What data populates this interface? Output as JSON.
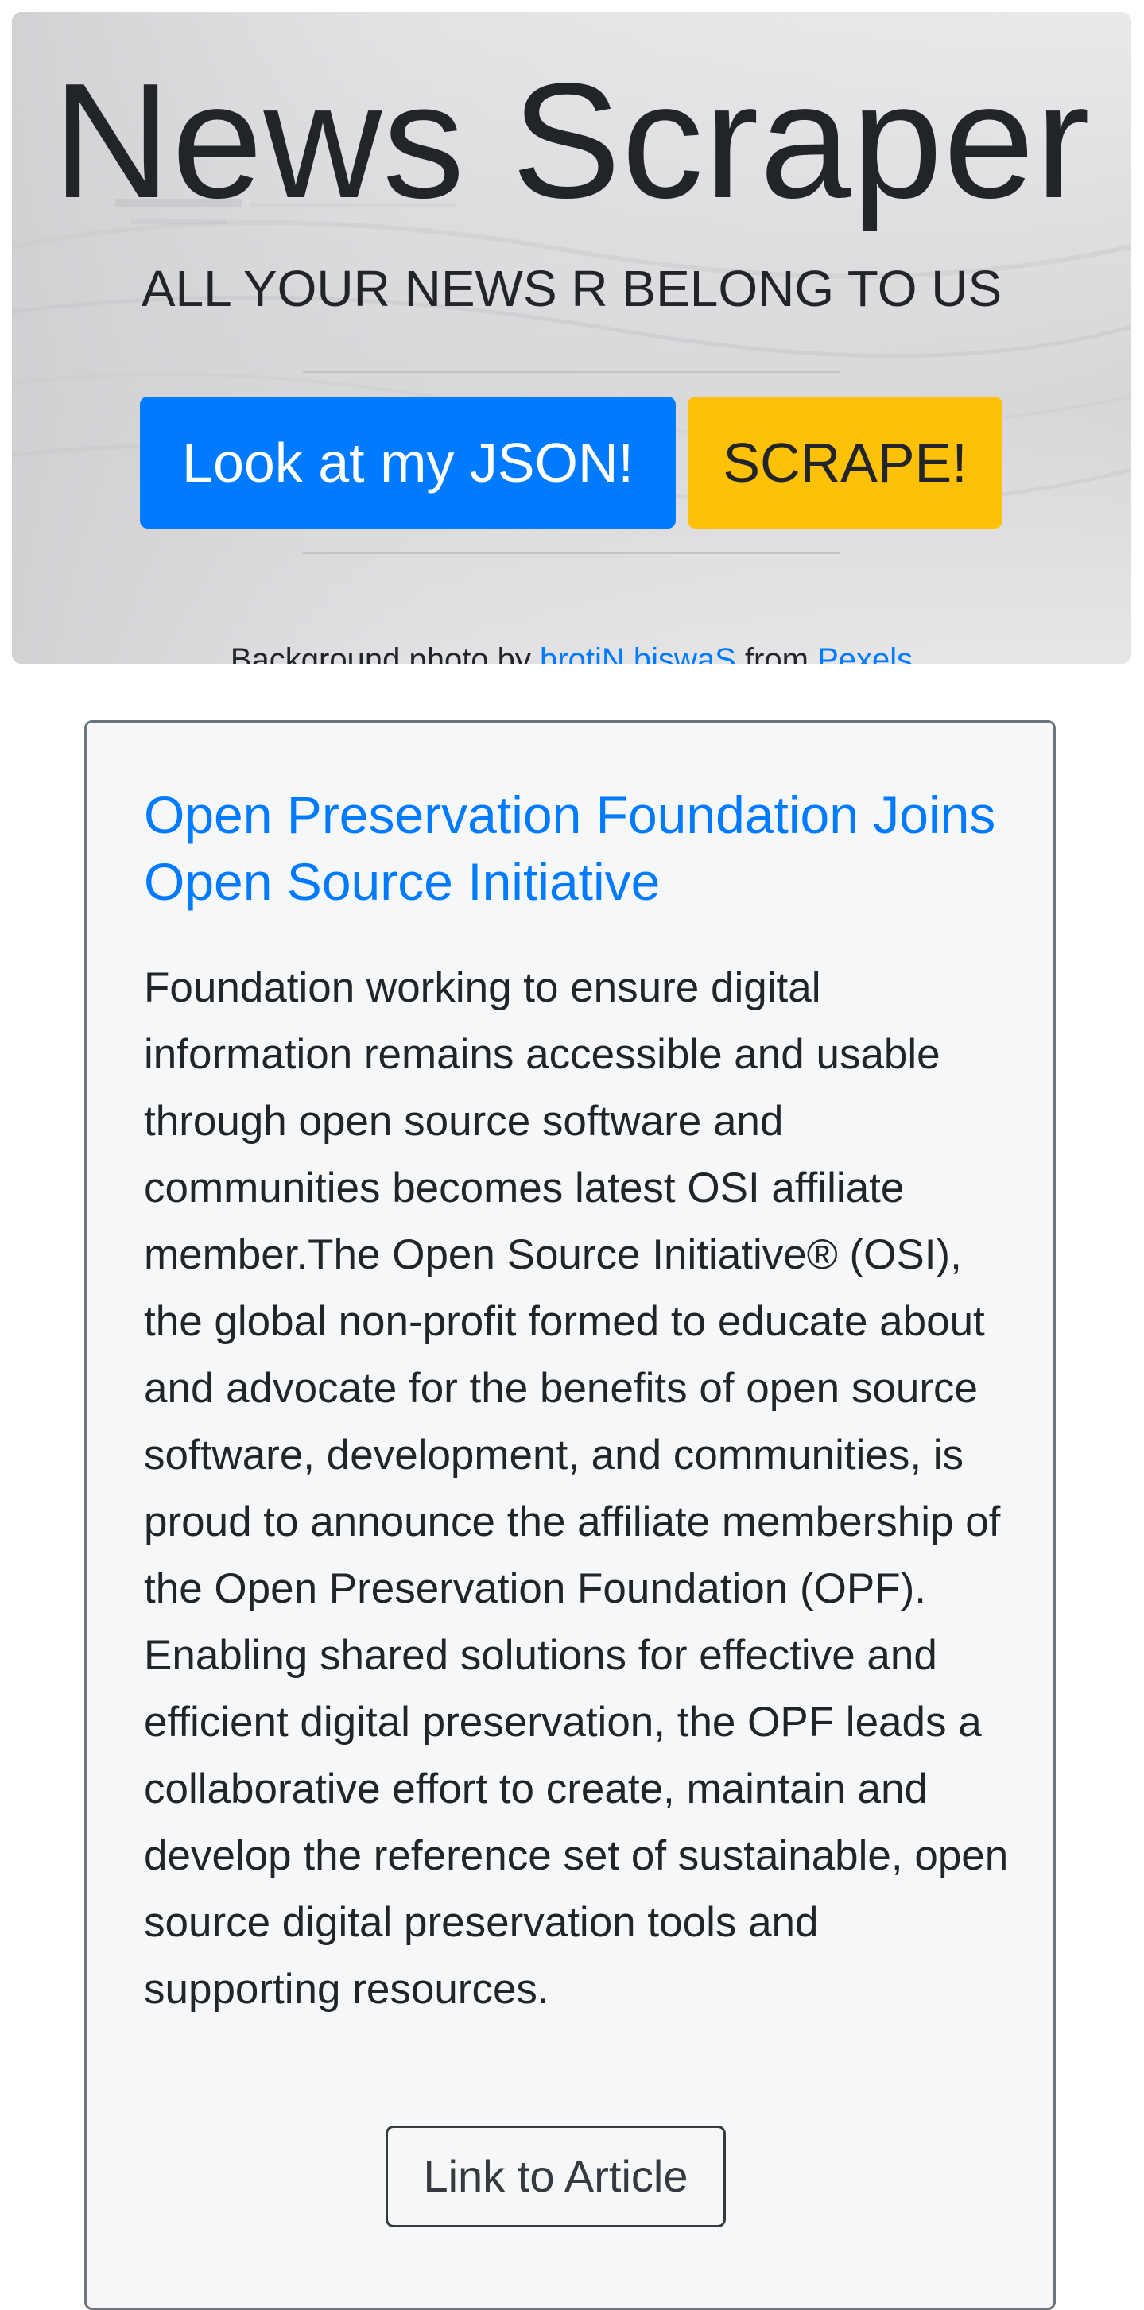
{
  "header": {
    "title": "News Scraper",
    "subtitle": "ALL YOUR NEWS R BELONG TO US",
    "json_button_label": "Look at my JSON!",
    "scrape_button_label": "SCRAPE!",
    "credit": {
      "prefix": "Background photo by",
      "photographer": "brotiN biswaS",
      "middle": "from",
      "source": "Pexels"
    }
  },
  "article": {
    "title": "Open Preservation Foundation Joins Open Source Initiative",
    "summary": "Foundation working to ensure digital information remains accessible and usable through open source software and communities becomes latest OSI affiliate member.The Open Source Initiative® (OSI), the global non-profit formed to educate about and advocate for the benefits of open source software, development, and communities, is proud to announce the affiliate membership of the Open Preservation Foundation (OPF). Enabling shared solutions for effective and efficient digital preservation, the OPF leads a collaborative effort to create, maintain and develop the reference set of sustainable, open source digital preservation tools and supporting resources.",
    "link_label": "Link to Article"
  },
  "colors": {
    "primary": "#007bff",
    "warning": "#ffc107",
    "card_border": "#6c757d",
    "text": "#212529"
  }
}
